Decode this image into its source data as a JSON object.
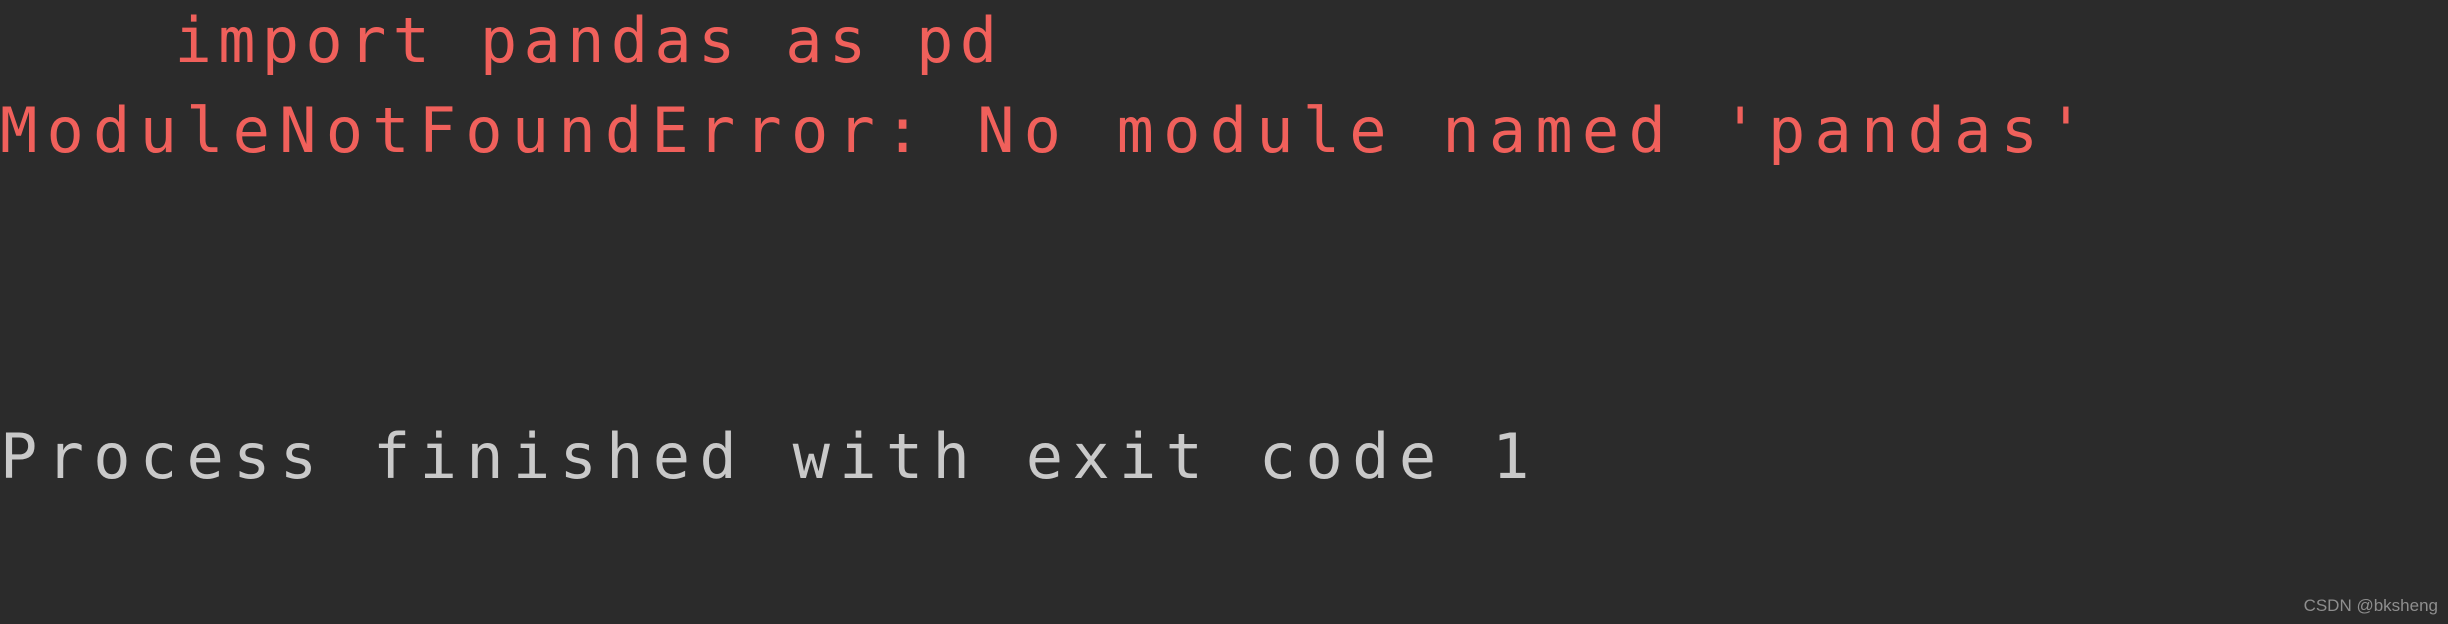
{
  "console": {
    "background_color": "#2b2b2b",
    "error_text_color": "#f0605b",
    "output_text_color": "#c9c9c9",
    "lines": [
      {
        "id": "import-statement",
        "text": "    import pandas as pd",
        "type": "traceback-source",
        "color": "#f0605b"
      },
      {
        "id": "error-message",
        "text": "ModuleNotFoundError: No module named 'pandas'",
        "type": "exception",
        "color": "#f0605b"
      },
      {
        "id": "blank-1",
        "text": "",
        "type": "blank"
      },
      {
        "id": "blank-2",
        "text": "",
        "type": "blank"
      },
      {
        "id": "exit-status",
        "text": "Process finished with exit code 1",
        "type": "status",
        "color": "#c9c9c9"
      }
    ],
    "exception_name": "ModuleNotFoundError",
    "missing_module": "pandas",
    "exit_code": "1"
  },
  "watermark": {
    "text": "CSDN @bksheng",
    "color": "#8e8e8e"
  }
}
